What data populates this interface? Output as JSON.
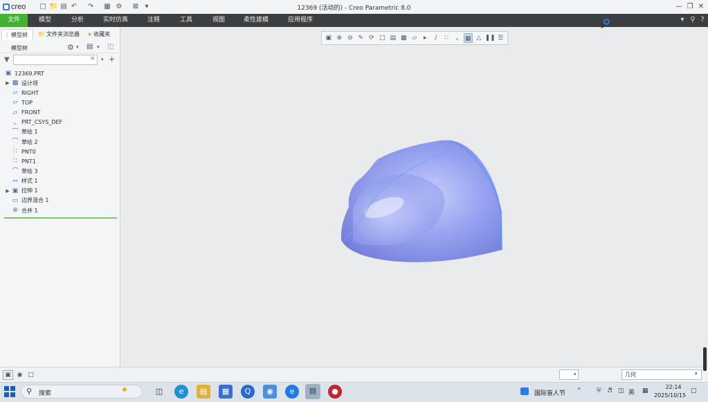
{
  "app": {
    "logo_text": "creo",
    "window_title": "12369 (活动的) - Creo Parametric 8.0",
    "accent_color": "#45b035"
  },
  "ribbon": {
    "tabs": [
      "文件",
      "模型",
      "分析",
      "实时仿真",
      "注释",
      "工具",
      "视图",
      "柔性建模",
      "应用程序"
    ]
  },
  "panel": {
    "tabs": [
      "模型树",
      "文件夹浏览器",
      "收藏夹"
    ],
    "tree_header": "模型树",
    "search_value": "",
    "items": [
      {
        "label": "12369.PRT",
        "icon": "part-icon",
        "expandable": false,
        "level": 0
      },
      {
        "label": "设计项",
        "icon": "design-items-icon",
        "expandable": true,
        "level": 1
      },
      {
        "label": "RIGHT",
        "icon": "datum-plane-icon",
        "expandable": false,
        "level": 1
      },
      {
        "label": "TOP",
        "icon": "datum-plane-icon",
        "expandable": false,
        "level": 1
      },
      {
        "label": "FRONT",
        "icon": "datum-plane-icon",
        "expandable": false,
        "level": 1
      },
      {
        "label": "PRT_CSYS_DEF",
        "icon": "csys-icon",
        "expandable": false,
        "level": 1
      },
      {
        "label": "草绘 1",
        "icon": "sketch-icon",
        "expandable": false,
        "level": 1
      },
      {
        "label": "草绘 2",
        "icon": "sketch-icon",
        "expandable": false,
        "level": 1
      },
      {
        "label": "PNT0",
        "icon": "datum-point-icon",
        "expandable": false,
        "level": 1
      },
      {
        "label": "PNT1",
        "icon": "datum-point-icon",
        "expandable": false,
        "level": 1
      },
      {
        "label": "草绘 3",
        "icon": "sketch-icon",
        "expandable": false,
        "level": 1
      },
      {
        "label": "样式 1",
        "icon": "style-icon",
        "expandable": false,
        "level": 1
      },
      {
        "label": "拉伸 1",
        "icon": "extrude-icon",
        "expandable": true,
        "level": 1
      },
      {
        "label": "边界混合 1",
        "icon": "boundary-blend-icon",
        "expandable": false,
        "level": 1
      },
      {
        "label": "合并 1",
        "icon": "merge-icon",
        "expandable": false,
        "level": 1
      }
    ]
  },
  "view_toolbar": {
    "tools": [
      "refit-icon",
      "zoom-in-icon",
      "zoom-out-icon",
      "repaint-icon",
      "spin-center-icon",
      "view-manager-icon",
      "saved-views-icon",
      "display-style-icon",
      "perspective-icon",
      "datum-plane-display-icon",
      "datum-axis-display-icon",
      "point-display-icon",
      "csys-display-icon",
      "annotation-display-icon",
      "simulation-icon",
      "pause-icon",
      "appearance-icon"
    ]
  },
  "status": {
    "selection_value": "",
    "filter_value": "几何"
  },
  "taskbar": {
    "search_label": "搜索",
    "news_label": "国际盲人节",
    "ime_label": "英",
    "time": "22:14",
    "date": "2025/10/15"
  }
}
